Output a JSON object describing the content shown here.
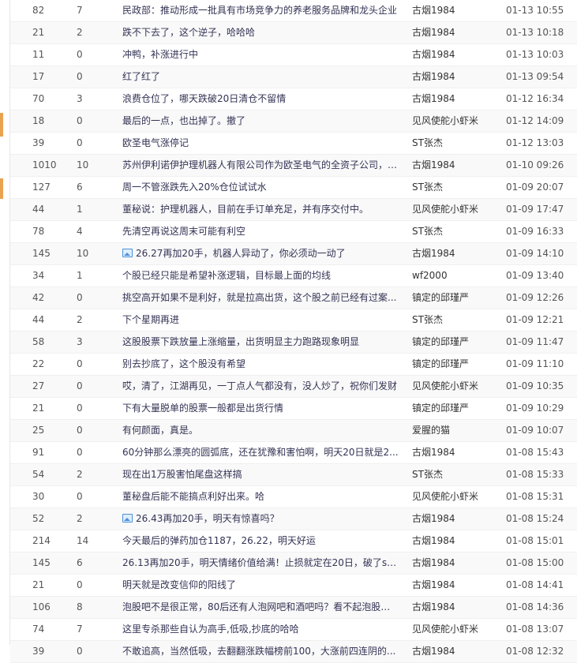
{
  "rows": [
    {
      "read": "82",
      "reply": "7",
      "title": "民政部：推动形成一批具有市场竞争力的养老服务品牌和龙头企业",
      "author": "古烟1984",
      "time": "01-13 10:55",
      "has_image": false
    },
    {
      "read": "21",
      "reply": "2",
      "title": "跌不下去了，这个逆子，哈哈哈",
      "author": "古烟1984",
      "time": "01-13 10:18",
      "has_image": false
    },
    {
      "read": "11",
      "reply": "0",
      "title": "冲鸭，补涨进行中",
      "author": "古烟1984",
      "time": "01-13 10:03",
      "has_image": false
    },
    {
      "read": "17",
      "reply": "0",
      "title": "红了红了",
      "author": "古烟1984",
      "time": "01-13 09:54",
      "has_image": false
    },
    {
      "read": "70",
      "reply": "3",
      "title": "浪费仓位了，哪天跌破20日清仓不留情",
      "author": "古烟1984",
      "time": "01-12 16:34",
      "has_image": false
    },
    {
      "read": "18",
      "reply": "0",
      "title": "最后的一点，也出掉了。撤了",
      "author": "见风使舵小虾米",
      "time": "01-12 14:09",
      "has_image": false
    },
    {
      "read": "39",
      "reply": "0",
      "title": "欧圣电气涨停记",
      "author": "ST张杰",
      "time": "01-12 13:03",
      "has_image": false
    },
    {
      "read": "1010",
      "reply": "10",
      "title": "苏州伊利诺伊护理机器人有限公司作为欧圣电气的全资子公司，其...",
      "author": "古烟1984",
      "time": "01-10 09:26",
      "has_image": false
    },
    {
      "read": "127",
      "reply": "6",
      "title": "周一不管涨跌先入20%仓位试试水",
      "author": "ST张杰",
      "time": "01-09 20:07",
      "has_image": false
    },
    {
      "read": "44",
      "reply": "1",
      "title": "董秘说：护理机器人，目前在手订单充足，并有序交付中。",
      "author": "见风使舵小虾米",
      "time": "01-09 17:47",
      "has_image": false
    },
    {
      "read": "78",
      "reply": "4",
      "title": "先清空再说这周末可能有利空",
      "author": "ST张杰",
      "time": "01-09 16:33",
      "has_image": false
    },
    {
      "read": "145",
      "reply": "10",
      "title": "26.27再加20手，机器人异动了，你必须动一动了",
      "author": "古烟1984",
      "time": "01-09 14:10",
      "has_image": true
    },
    {
      "read": "34",
      "reply": "1",
      "title": "个股已经只能是希望补涨逻辑，目标最上面的均线",
      "author": "wf2000",
      "time": "01-09 13:40",
      "has_image": false
    },
    {
      "read": "42",
      "reply": "0",
      "title": "挑空高开如果不是利好，就是拉高出货，这个股之前已经有过案...",
      "author": "镇定的邱瑾严",
      "time": "01-09 12:26",
      "has_image": false
    },
    {
      "read": "44",
      "reply": "2",
      "title": "下个星期再进",
      "author": "ST张杰",
      "time": "01-09 12:21",
      "has_image": false
    },
    {
      "read": "58",
      "reply": "3",
      "title": "这股股票下跌放量上涨缩量，出货明显主力跑路现象明显",
      "author": "镇定的邱瑾严",
      "time": "01-09 11:47",
      "has_image": false
    },
    {
      "read": "22",
      "reply": "0",
      "title": "别去抄底了，这个股没有希望",
      "author": "镇定的邱瑾严",
      "time": "01-09 11:10",
      "has_image": false
    },
    {
      "read": "27",
      "reply": "0",
      "title": "哎，清了，江湖再见，一丁点人气都没有，没人炒了，祝你们发财",
      "author": "见风使舵小虾米",
      "time": "01-09 10:35",
      "has_image": false
    },
    {
      "read": "21",
      "reply": "0",
      "title": "下有大量脱单的股票一般都是出货行情",
      "author": "镇定的邱瑾严",
      "time": "01-09 10:29",
      "has_image": false
    },
    {
      "read": "25",
      "reply": "0",
      "title": "有何颜面，真是。",
      "author": "爱腥的猫",
      "time": "01-09 10:07",
      "has_image": false
    },
    {
      "read": "91",
      "reply": "0",
      "title": "60分钟那么漂亮的圆弧底，还在犹豫和害怕啊，明天20日就是2...",
      "author": "古烟1984",
      "time": "01-08 15:43",
      "has_image": false
    },
    {
      "read": "54",
      "reply": "2",
      "title": "现在出1万股害怕尾盘这样搞",
      "author": "ST张杰",
      "time": "01-08 15:33",
      "has_image": false
    },
    {
      "read": "30",
      "reply": "0",
      "title": "董秘盘后能不能搞点利好出来。哈",
      "author": "见风使舵小虾米",
      "time": "01-08 15:31",
      "has_image": false
    },
    {
      "read": "52",
      "reply": "2",
      "title": "26.43再加20手，明天有惊喜吗？",
      "author": "古烟1984",
      "time": "01-08 15:24",
      "has_image": true
    },
    {
      "read": "214",
      "reply": "14",
      "title": "今天最后的弹药加仓1187，26.22，明天好运",
      "author": "古烟1984",
      "time": "01-08 15:01",
      "has_image": false
    },
    {
      "read": "145",
      "reply": "6",
      "title": "26.13再加20手，明天情绪价值给满！止损就定在20日，破了say...",
      "author": "古烟1984",
      "time": "01-08 15:00",
      "has_image": false
    },
    {
      "read": "21",
      "reply": "0",
      "title": "明天就是改变信仰的阳线了",
      "author": "古烟1984",
      "time": "01-08 14:41",
      "has_image": false
    },
    {
      "read": "106",
      "reply": "8",
      "title": "泡股吧不是很正常，80后还有人泡网吧和酒吧吗？看不起泡股吧...",
      "author": "古烟1984",
      "time": "01-08 14:36",
      "has_image": false
    },
    {
      "read": "74",
      "reply": "7",
      "title": "这里专杀那些自认为高手,低吸,抄底的哈哈",
      "author": "见风使舵小虾米",
      "time": "01-08 13:07",
      "has_image": false
    },
    {
      "read": "39",
      "reply": "0",
      "title": "不敢追高，当然低吸，去翻翻涨跌幅榜前100，大涨前四连阴的...",
      "author": "古烟1984",
      "time": "01-08 12:32",
      "has_image": false
    }
  ],
  "colors": {
    "accent": "#e9a34f",
    "image_icon": "#4a90d9",
    "row_alt": "#f9f9f9"
  }
}
